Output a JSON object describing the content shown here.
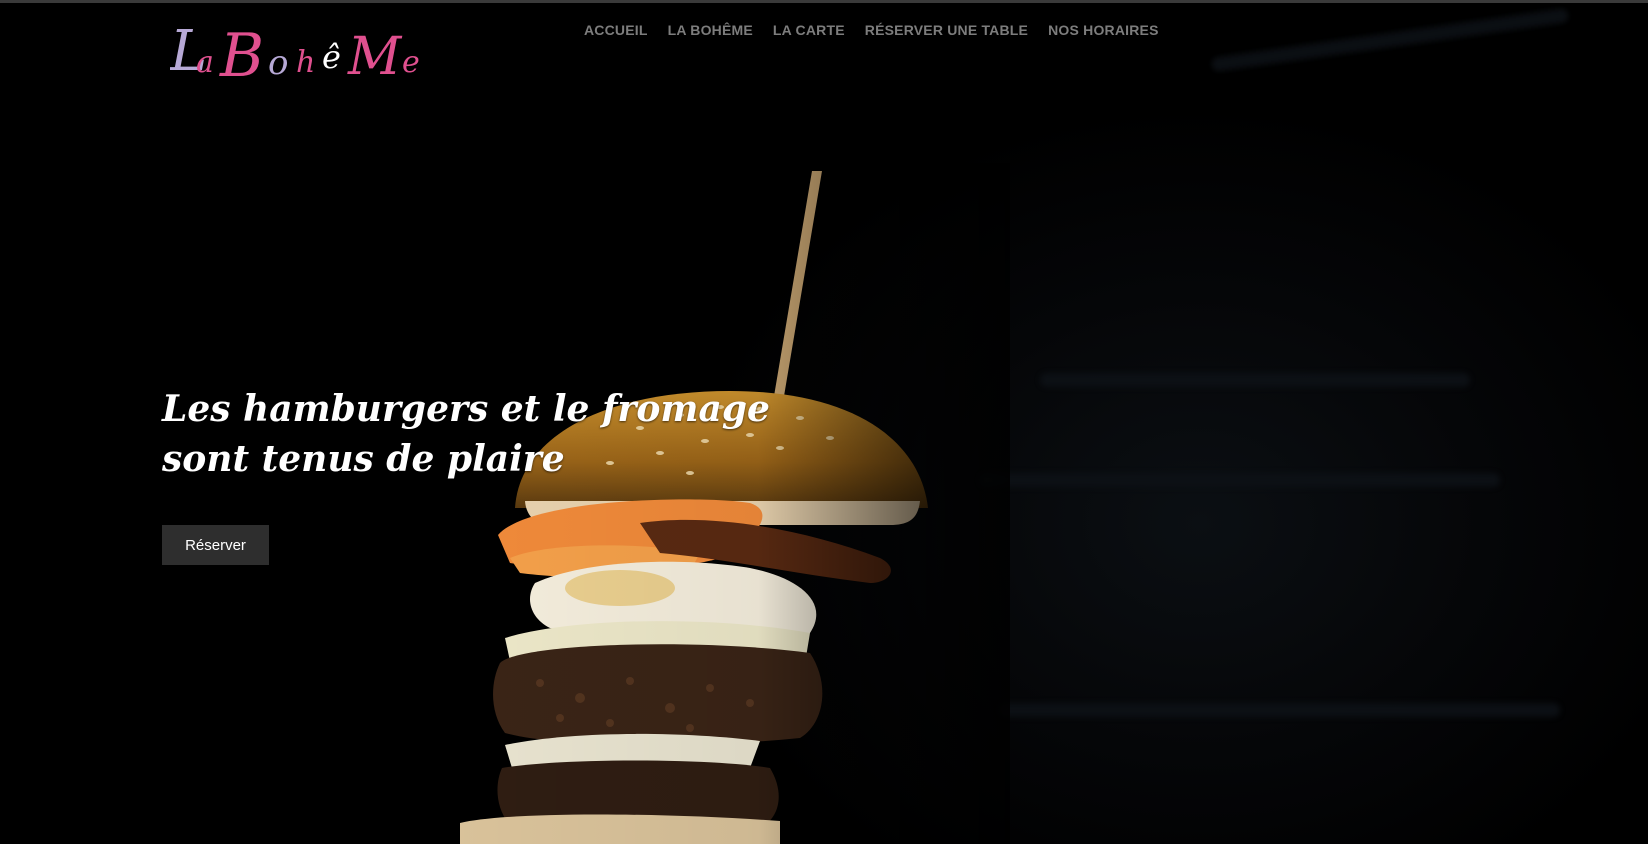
{
  "brand": {
    "logo_text": "LaBohêMe",
    "logo_name": "la-boheme-logo"
  },
  "nav": {
    "items": [
      {
        "label": "ACCUEIL"
      },
      {
        "label": "LA BOHÊME"
      },
      {
        "label": "LA CARTE"
      },
      {
        "label": "RÉSERVER UNE TABLE"
      },
      {
        "label": "NOS HORAIRES"
      }
    ]
  },
  "hero": {
    "headline": "Les hamburgers et le fromage sont tenus de plaire",
    "cta_label": "Réserver",
    "image_subject": "burger-photo"
  },
  "colors": {
    "nav_text": "#7d7d7d",
    "button_bg": "#2e2e2e",
    "logo_pink": "#e0508f",
    "logo_lavender": "#b7a9d6"
  }
}
